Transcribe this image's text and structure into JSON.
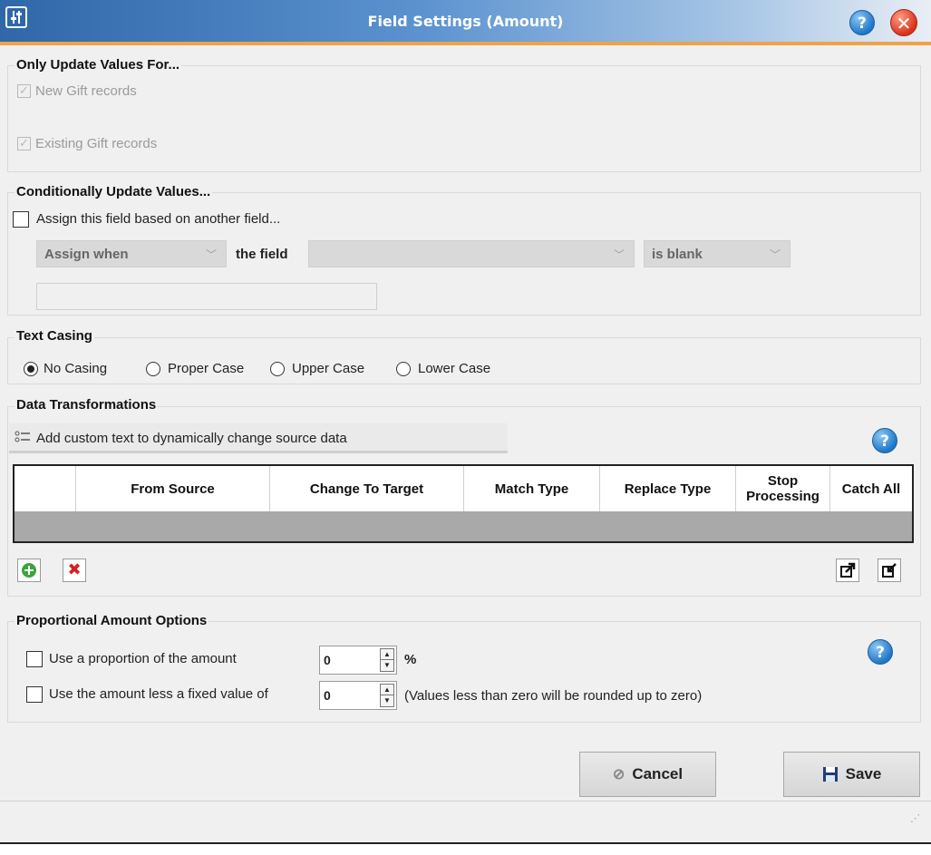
{
  "window": {
    "title": "Field Settings (Amount)",
    "logo_icon": "settings-sliders-icon",
    "help_icon": "help-icon",
    "close_icon": "close-icon",
    "accent_color": "#f0a24a",
    "title_bar_color": "#2f67a8"
  },
  "only_update": {
    "title": "Only Update Values For...",
    "new_gift": "New Gift records",
    "existing_gift": "Existing Gift records"
  },
  "conditional": {
    "title": "Conditionally Update Values...",
    "assign_checkbox": "Assign this field based on another field...",
    "assign_when": "Assign when",
    "the_field": "the field",
    "field_value": "",
    "condition": "is blank",
    "value_text": ""
  },
  "text_casing": {
    "title": "Text Casing",
    "options": [
      "No Casing",
      "Proper Case",
      "Upper Case",
      "Lower Case"
    ],
    "selected": "No Casing"
  },
  "transformations": {
    "title": "Data Transformations",
    "add_custom_text": "Add custom text to dynamically change source data",
    "columns": [
      "",
      "From Source",
      "Change To Target",
      "Match Type",
      "Replace Type",
      "Stop Processing",
      "Catch All"
    ],
    "add_icon": "add-icon",
    "delete_icon": "delete-icon",
    "export_icon": "export-icon",
    "import_icon": "import-icon"
  },
  "proportional": {
    "title": "Proportional Amount Options",
    "use_proportion": "Use a proportion of the amount",
    "proportion_value": "0",
    "percent": "%",
    "use_less_fixed": "Use the amount less a fixed value of",
    "fixed_value": "0",
    "note": "(Values less than zero will be rounded up to zero)"
  },
  "buttons": {
    "cancel": "Cancel",
    "save": "Save"
  }
}
